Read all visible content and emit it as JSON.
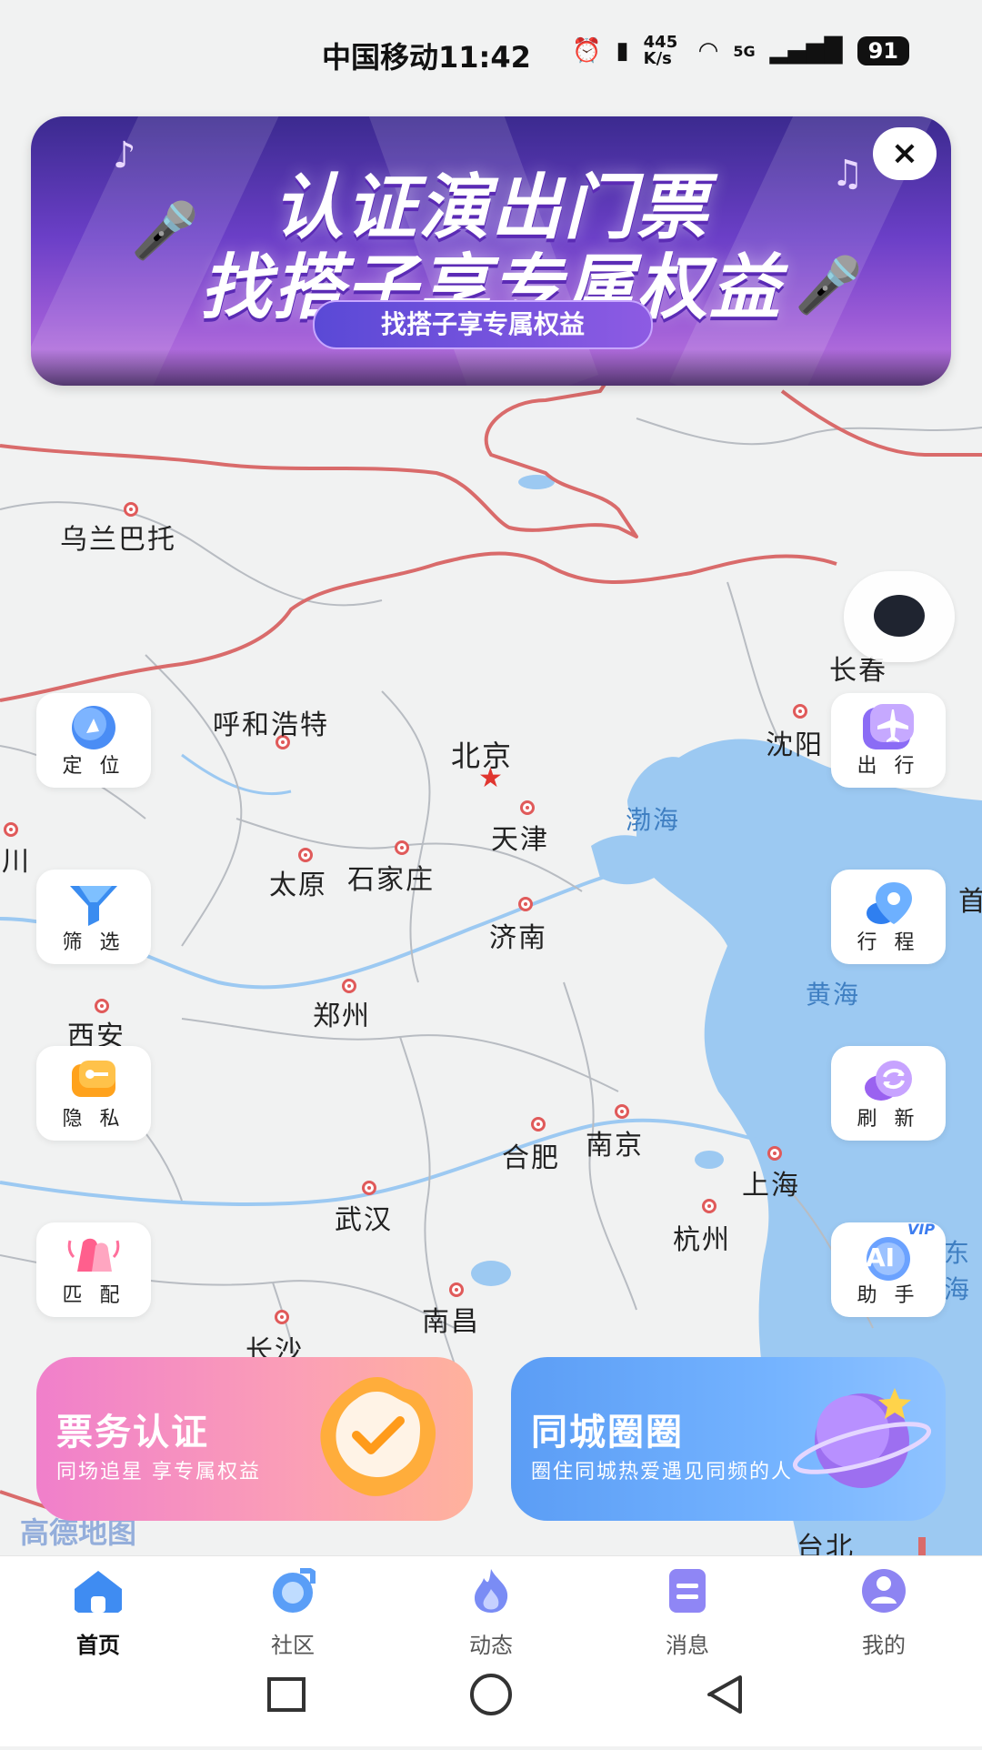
{
  "status_bar": {
    "carrier": "中国移动",
    "time": "11:42",
    "net_speed": "445 K/s",
    "network": "5G",
    "battery": "91"
  },
  "banner": {
    "line1": "认证演出门票",
    "line2": "找搭子享专属权益",
    "pill": "找搭子享专属权益",
    "close": "×"
  },
  "map": {
    "cities": [
      {
        "name": "乌兰巴托"
      },
      {
        "name": "呼和浩特"
      },
      {
        "name": "北京"
      },
      {
        "name": "天津"
      },
      {
        "name": "沈阳"
      },
      {
        "name": "长春"
      },
      {
        "name": "太原"
      },
      {
        "name": "石家庄"
      },
      {
        "name": "济南"
      },
      {
        "name": "郑州"
      },
      {
        "name": "西安"
      },
      {
        "name": "合肥"
      },
      {
        "name": "南京"
      },
      {
        "name": "上海"
      },
      {
        "name": "武汉"
      },
      {
        "name": "杭州"
      },
      {
        "name": "南昌"
      },
      {
        "name": "长沙"
      },
      {
        "name": "台北"
      },
      {
        "name": "银川"
      },
      {
        "name": "首"
      }
    ],
    "seas": [
      "渤海",
      "黄海",
      "东海"
    ],
    "watermark": "高德地图"
  },
  "left_controls": [
    {
      "label": "定 位",
      "icon": "compass-icon"
    },
    {
      "label": "筛 选",
      "icon": "filter-icon"
    },
    {
      "label": "隐 私",
      "icon": "key-icon"
    },
    {
      "label": "匹 配",
      "icon": "bell-icon"
    }
  ],
  "right_controls": [
    {
      "label": "出 行",
      "icon": "airplane-icon"
    },
    {
      "label": "行 程",
      "icon": "location-pin-icon"
    },
    {
      "label": "刷 新",
      "icon": "refresh-icon"
    },
    {
      "label": "助 手",
      "icon": "ai-assistant-icon"
    }
  ],
  "ai_badge": "AI",
  "vip_badge": "VIP",
  "cards": [
    {
      "title": "票务认证",
      "subtitle": "同场追星 享专属权益"
    },
    {
      "title": "同城圈圈",
      "subtitle": "圈住同城热爱遇见同频的人"
    }
  ],
  "tabs": [
    {
      "label": "首页",
      "active": true
    },
    {
      "label": "社区",
      "active": false
    },
    {
      "label": "动态",
      "active": false
    },
    {
      "label": "消息",
      "active": false
    },
    {
      "label": "我的",
      "active": false
    }
  ],
  "colors": {
    "sea": "#9cc9f2",
    "border": "#d96b6b",
    "accent": "#6b8cf5",
    "card_left": "#f07fc8",
    "card_right": "#5b9df5"
  }
}
